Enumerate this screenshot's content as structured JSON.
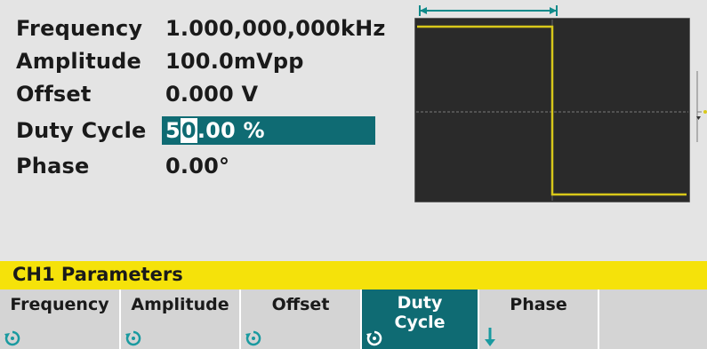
{
  "parameters": [
    {
      "name": "Frequency",
      "value": "1.000,000,000kHz"
    },
    {
      "name": "Amplitude",
      "value": "100.0mVpp"
    },
    {
      "name": "Offset",
      "value": "0.000 V"
    },
    {
      "name": "Duty Cycle",
      "value_prefix": "5",
      "value_cursor": "0",
      "value_suffix": ".00 %"
    },
    {
      "name": "Phase",
      "value": "0.00°"
    }
  ],
  "status_bar": {
    "text": "CH1  Parameters"
  },
  "softkeys": [
    {
      "label": "Frequency",
      "icon": "knob-icon"
    },
    {
      "label": "Amplitude",
      "icon": "knob-icon"
    },
    {
      "label": "Offset",
      "icon": "knob-icon"
    },
    {
      "label": "Duty\nCycle",
      "icon": "knob-icon",
      "active": true
    },
    {
      "label": "Phase",
      "icon": "down-arrow-icon"
    },
    {
      "label": ""
    }
  ],
  "colors": {
    "accent": "#0f6b73",
    "status": "#f5e20a",
    "waveform": "#d8c81a",
    "screen": "#2a2a2a"
  }
}
